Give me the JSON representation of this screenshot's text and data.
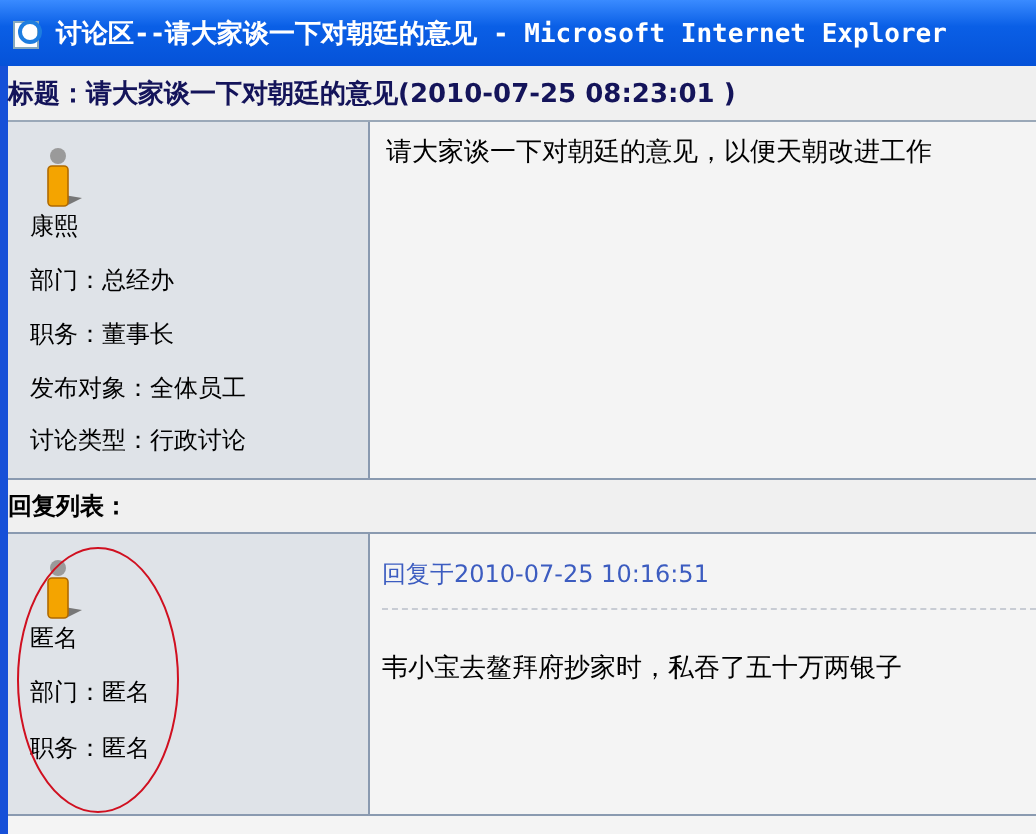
{
  "window": {
    "title": "讨论区--请大家谈一下对朝廷的意见 - Microsoft Internet Explorer"
  },
  "topic": {
    "title": "标题：请大家谈一下对朝廷的意见(2010-07-25 08:23:01 )"
  },
  "post": {
    "author": "康熙",
    "fields": [
      {
        "label": "部门：",
        "value": "总经办"
      },
      {
        "label": "职务：",
        "value": "董事长"
      },
      {
        "label": "发布对象：",
        "value": "全体员工"
      },
      {
        "label": "讨论类型：",
        "value": "行政讨论"
      }
    ],
    "body": "请大家谈一下对朝廷的意见，以便天朝改进工作"
  },
  "replies_heading": "回复列表：",
  "replies": [
    {
      "author": "匿名",
      "fields": [
        {
          "label": "部门：",
          "value": "匿名"
        },
        {
          "label": "职务：",
          "value": "匿名"
        }
      ],
      "meta": "回复于2010-07-25 10:16:51",
      "body": "韦小宝去鳌拜府抄家时，私吞了五十万两银子",
      "circled": true
    }
  ]
}
